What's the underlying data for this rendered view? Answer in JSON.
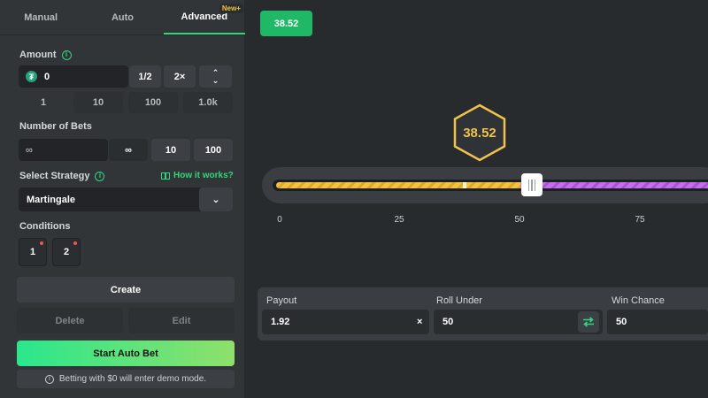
{
  "tabs": [
    {
      "label": "Manual"
    },
    {
      "label": "Auto"
    },
    {
      "label": "Advanced",
      "badge": "New+"
    }
  ],
  "amount": {
    "label": "Amount",
    "value": "0",
    "half_label": "1/2",
    "double_label": "2×",
    "up_glyph": "⌃",
    "down_glyph": "⌄",
    "presets": [
      "1",
      "10",
      "100",
      "1.0k"
    ]
  },
  "bets": {
    "label": "Number of Bets",
    "value": "∞",
    "options": [
      "∞",
      "10",
      "100"
    ]
  },
  "strategy": {
    "label": "Select Strategy",
    "how_label": "How it works?",
    "selected": "Martingale"
  },
  "conditions": {
    "label": "Conditions",
    "items": [
      "1",
      "2"
    ]
  },
  "actions": {
    "create": "Create",
    "delete": "Delete",
    "edit": "Edit",
    "start": "Start Auto Bet",
    "demo_note": "Betting with $0 will enter demo mode."
  },
  "game": {
    "last_result": "38.52",
    "hex_result": "38.52",
    "roll_under_fraction": 0.5,
    "result_fraction": 0.3852,
    "ticks": [
      "0",
      "25",
      "50",
      "75"
    ]
  },
  "stats": {
    "payout_label": "Payout",
    "payout_value": "1.92",
    "payout_suffix": "×",
    "roll_label": "Roll Under",
    "roll_value": "50",
    "chance_label": "Win Chance",
    "chance_value": "50"
  },
  "colors": {
    "accent_green": "#2fd67e",
    "result_green": "#1fb866",
    "hex_gold": "#f2c34a",
    "slider_yellow": "#f4c23c",
    "slider_purple": "#c66df0"
  }
}
